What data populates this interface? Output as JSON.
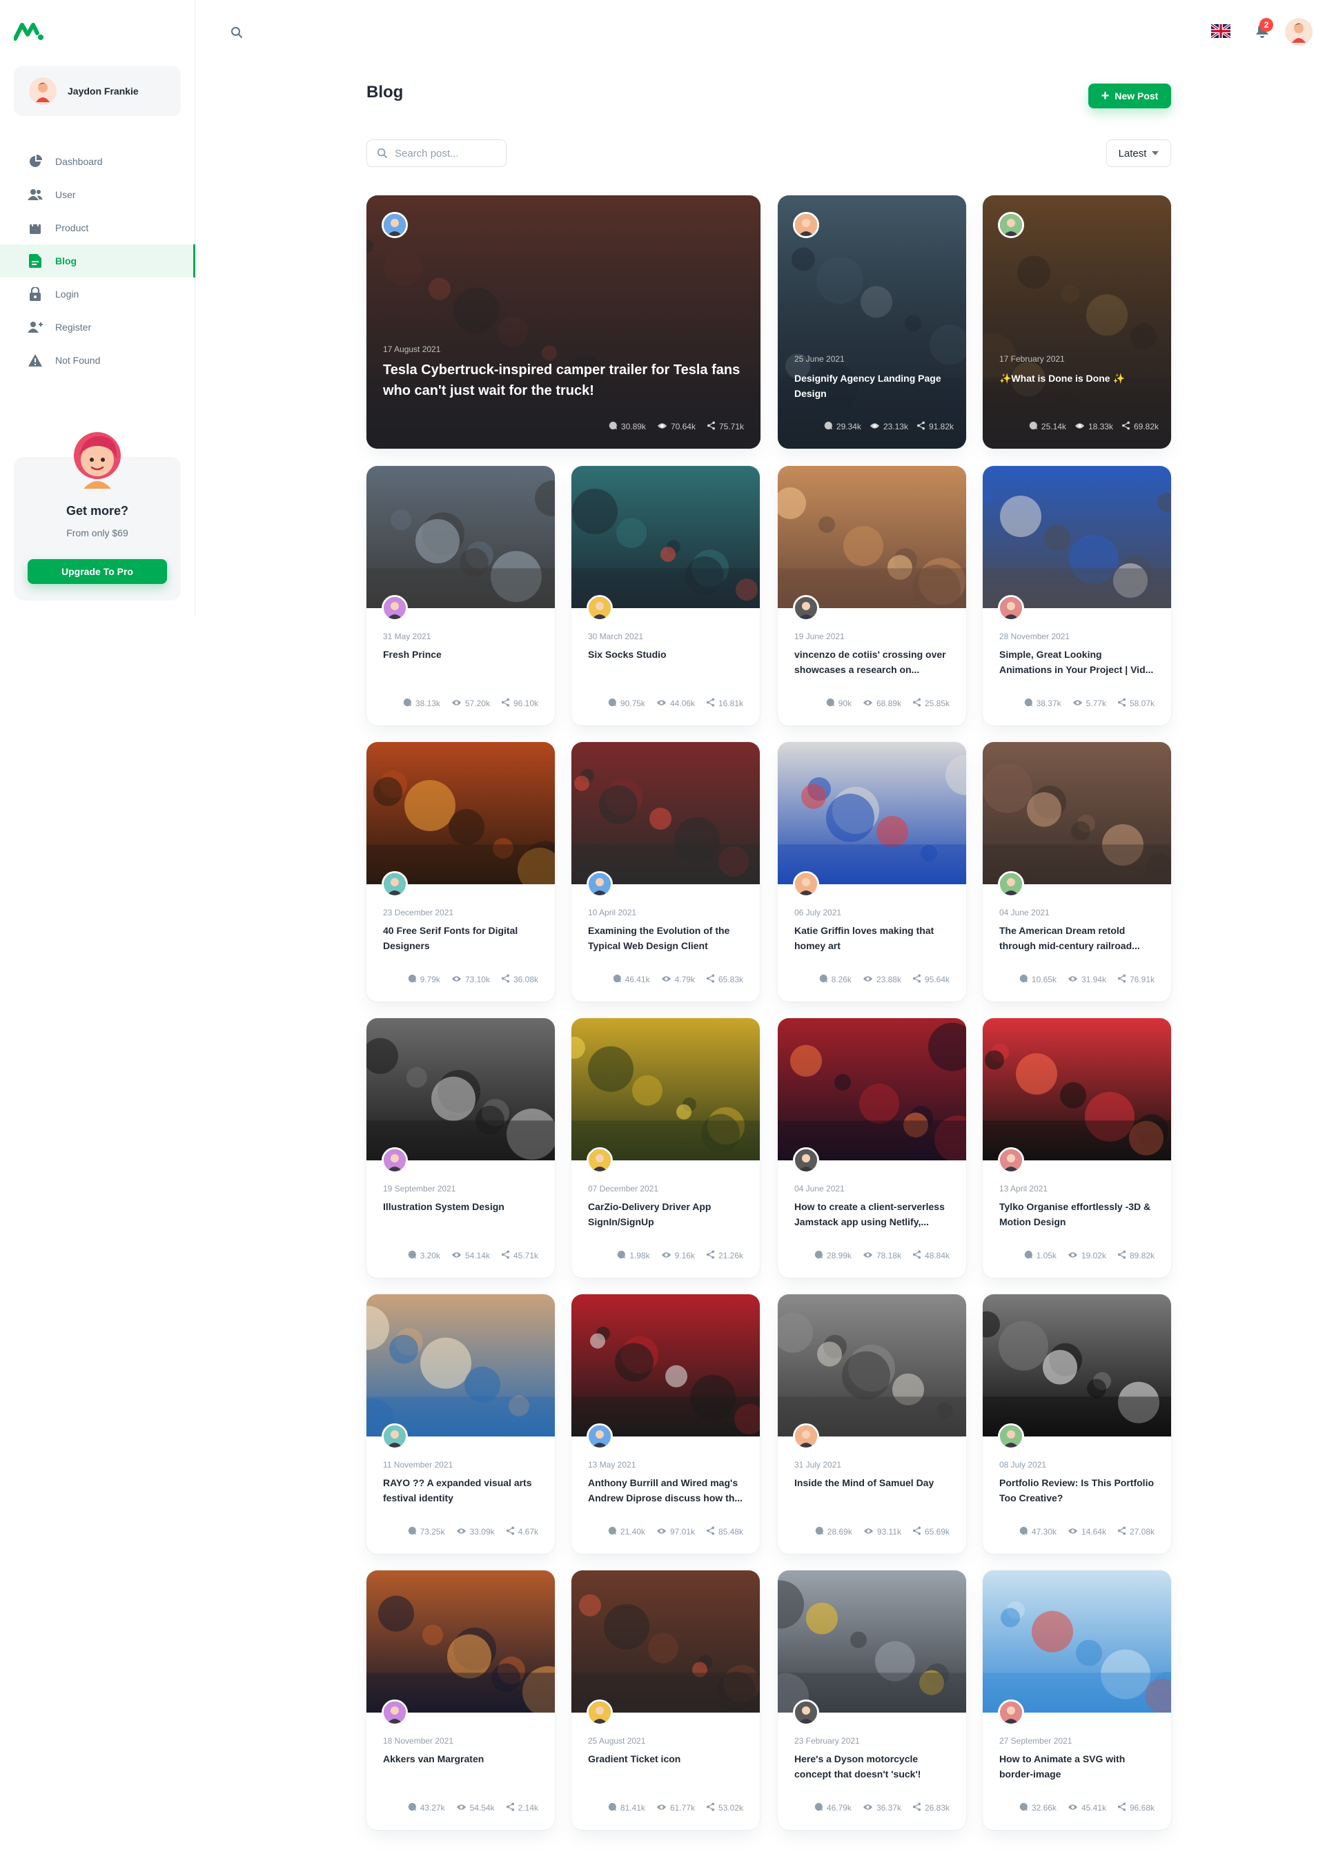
{
  "sidebar": {
    "account_name": "Jaydon Frankie",
    "nav": [
      {
        "label": "Dashboard",
        "icon": "pie-chart-icon"
      },
      {
        "label": "User",
        "icon": "people-icon"
      },
      {
        "label": "Product",
        "icon": "shopping-bag-icon"
      },
      {
        "label": "Blog",
        "icon": "file-text-icon",
        "active": true
      },
      {
        "label": "Login",
        "icon": "lock-icon"
      },
      {
        "label": "Register",
        "icon": "person-add-icon"
      },
      {
        "label": "Not Found",
        "icon": "alert-triangle-icon"
      }
    ],
    "promo": {
      "title": "Get more?",
      "subtitle": "From only $69",
      "button": "Upgrade To Pro"
    }
  },
  "topbar": {
    "notifications_count": "2"
  },
  "page": {
    "title": "Blog",
    "new_post_label": "New Post",
    "search_placeholder": "Search post...",
    "sort_label": "Latest"
  },
  "colors": {
    "primary": "#00AB55",
    "error": "#FF4842",
    "text_primary": "#212B36",
    "text_secondary": "#637381",
    "text_disabled": "#919EAB"
  },
  "posts": [
    {
      "date": "17 August 2021",
      "title": "Tesla Cybertruck-inspired camper trailer for Tesla fans who can't just wait for the truck!",
      "comments": "30.89k",
      "views": "70.64k",
      "shares": "75.71k"
    },
    {
      "date": "25 June 2021",
      "title": "Designify Agency Landing Page Design",
      "comments": "29.34k",
      "views": "23.13k",
      "shares": "91.82k"
    },
    {
      "date": "17 February 2021",
      "title": "✨What is Done is Done ✨",
      "comments": "25.14k",
      "views": "18.33k",
      "shares": "69.82k"
    },
    {
      "date": "31 May 2021",
      "title": "Fresh Prince",
      "comments": "38.13k",
      "views": "57.20k",
      "shares": "96.10k"
    },
    {
      "date": "30 March 2021",
      "title": "Six Socks Studio",
      "comments": "90.75k",
      "views": "44.06k",
      "shares": "16.81k"
    },
    {
      "date": "19 June 2021",
      "title": "vincenzo de cotiis' crossing over showcases a research on...",
      "comments": "90k",
      "views": "68.89k",
      "shares": "25.85k"
    },
    {
      "date": "28 November 2021",
      "title": "Simple, Great Looking Animations in Your Project | Vid...",
      "comments": "38.37k",
      "views": "5.77k",
      "shares": "58.07k"
    },
    {
      "date": "23 December 2021",
      "title": "40 Free Serif Fonts for Digital Designers",
      "comments": "9.79k",
      "views": "73.10k",
      "shares": "36.08k"
    },
    {
      "date": "10 April 2021",
      "title": "Examining the Evolution of the Typical Web Design Client",
      "comments": "46.41k",
      "views": "4.79k",
      "shares": "65.83k"
    },
    {
      "date": "06 July 2021",
      "title": "Katie Griffin loves making that homey art",
      "comments": "8.26k",
      "views": "23.88k",
      "shares": "95.64k"
    },
    {
      "date": "04 June 2021",
      "title": "The American Dream retold through mid-century railroad...",
      "comments": "10.65k",
      "views": "31.94k",
      "shares": "76.91k"
    },
    {
      "date": "19 September 2021",
      "title": "Illustration System Design",
      "comments": "3.20k",
      "views": "54.14k",
      "shares": "45.71k"
    },
    {
      "date": "07 December 2021",
      "title": "CarZio-Delivery Driver App SignIn/SignUp",
      "comments": "1.98k",
      "views": "9.16k",
      "shares": "21.26k"
    },
    {
      "date": "04 June 2021",
      "title": "How to create a client-serverless Jamstack app using Netlify,...",
      "comments": "28.99k",
      "views": "78.18k",
      "shares": "48.84k"
    },
    {
      "date": "13 April 2021",
      "title": "Tylko Organise effortlessly -3D & Motion Design",
      "comments": "1.05k",
      "views": "19.02k",
      "shares": "89.82k"
    },
    {
      "date": "11 November 2021",
      "title": "RAYO ?? A expanded visual arts festival identity",
      "comments": "73.25k",
      "views": "33.09k",
      "shares": "4.67k"
    },
    {
      "date": "13 May 2021",
      "title": "Anthony Burrill and Wired mag's Andrew Diprose discuss how th...",
      "comments": "21.40k",
      "views": "97.01k",
      "shares": "85.48k"
    },
    {
      "date": "31 July 2021",
      "title": "Inside the Mind of Samuel Day",
      "comments": "28.69k",
      "views": "93.11k",
      "shares": "65.69k"
    },
    {
      "date": "08 July 2021",
      "title": "Portfolio Review: Is This Portfolio Too Creative?",
      "comments": "47.30k",
      "views": "14.64k",
      "shares": "27.08k"
    },
    {
      "date": "18 November 2021",
      "title": "Akkers van Margraten",
      "comments": "43.27k",
      "views": "54.54k",
      "shares": "2.14k"
    },
    {
      "date": "25 August 2021",
      "title": "Gradient Ticket icon",
      "comments": "81.41k",
      "views": "61.77k",
      "shares": "53.02k"
    },
    {
      "date": "23 February 2021",
      "title": "Here's a Dyson motorcycle concept that doesn't 'suck'!",
      "comments": "46.79k",
      "views": "36.37k",
      "shares": "26.83k"
    },
    {
      "date": "27 September 2021",
      "title": "How to Animate a SVG with border-image",
      "comments": "32.66k",
      "views": "45.41k",
      "shares": "96.68k"
    }
  ]
}
